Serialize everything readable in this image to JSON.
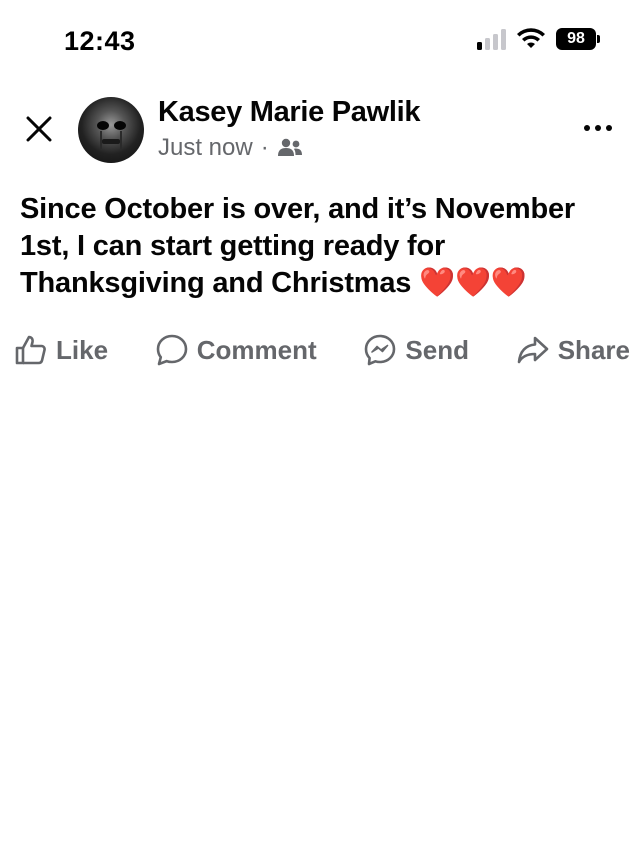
{
  "status_bar": {
    "time": "12:43",
    "battery": "98",
    "signal_bars_active": 1,
    "signal_bars_total": 4
  },
  "post": {
    "author": "Kasey Marie Pawlik",
    "timestamp": "Just now",
    "separator": "·",
    "audience_icon": "friends-icon",
    "text": "Since October is over, and it’s November 1st, I can start getting ready for Thanksgiving and Christmas ",
    "emoji": "❤️❤️❤️"
  },
  "actions": {
    "like": "Like",
    "comment": "Comment",
    "send": "Send",
    "share": "Share"
  },
  "icons": {
    "close": "close-icon",
    "more": "more-icon",
    "like": "thumbs-up-icon",
    "comment": "comment-bubble-icon",
    "send": "messenger-icon",
    "share": "share-arrow-icon"
  },
  "colors": {
    "text": "#050505",
    "secondary": "#65676b",
    "heart": "#e0245e"
  }
}
